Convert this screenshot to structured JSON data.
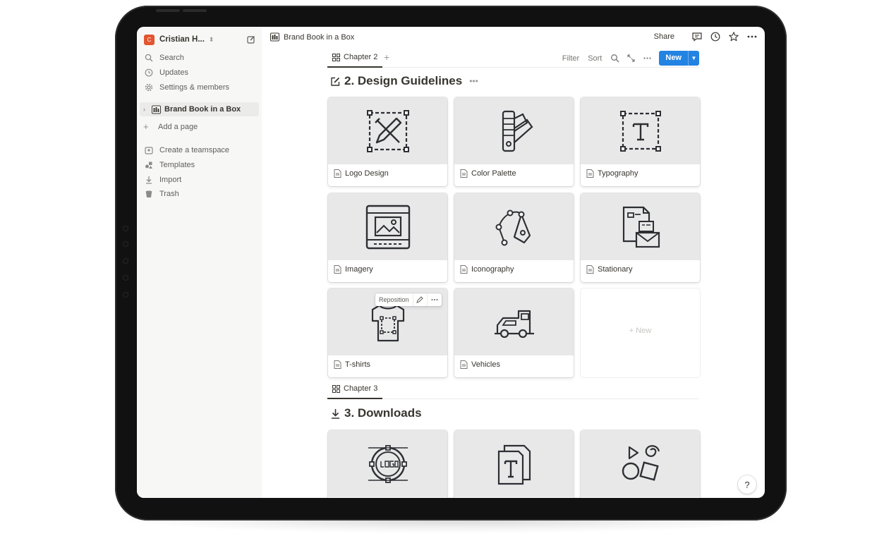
{
  "workspace": {
    "avatar_letter": "C",
    "name": "Cristian H...",
    "accent": "#e1552f"
  },
  "sidebar": {
    "nav": [
      {
        "label": "Search",
        "icon": "search-icon"
      },
      {
        "label": "Updates",
        "icon": "clock-icon"
      },
      {
        "label": "Settings & members",
        "icon": "gear-icon"
      }
    ],
    "page": {
      "label": "Brand Book in a Box",
      "icon": "book-icon"
    },
    "add_page": "Add a page",
    "extras": [
      {
        "label": "Create a teamspace",
        "icon": "teamspace-icon"
      },
      {
        "label": "Templates",
        "icon": "templates-icon"
      },
      {
        "label": "Import",
        "icon": "import-icon"
      },
      {
        "label": "Trash",
        "icon": "trash-icon"
      }
    ]
  },
  "topbar": {
    "breadcrumb": "Brand Book in a Box",
    "share": "Share"
  },
  "views": {
    "chapter2": "Chapter 2",
    "chapter3": "Chapter 3",
    "filter": "Filter",
    "sort": "Sort",
    "new": "New",
    "accent": "#2383e2"
  },
  "sections": {
    "design": {
      "title": "2. Design Guidelines",
      "icon": "edit-icon"
    },
    "downloads": {
      "title": "3. Downloads",
      "icon": "download-icon"
    }
  },
  "cards": [
    {
      "label": "Logo Design",
      "icon": "logo-design-icon"
    },
    {
      "label": "Color Palette",
      "icon": "color-palette-icon"
    },
    {
      "label": "Typography",
      "icon": "typography-icon"
    },
    {
      "label": "Imagery",
      "icon": "imagery-icon"
    },
    {
      "label": "Iconography",
      "icon": "iconography-icon"
    },
    {
      "label": "Stationary",
      "icon": "stationary-icon"
    },
    {
      "label": "T-shirts",
      "icon": "tshirt-icon"
    },
    {
      "label": "Vehicles",
      "icon": "vehicle-icon"
    }
  ],
  "new_card": "New",
  "reposition": "Reposition",
  "download_cards": [
    {
      "icon": "logo-download-icon"
    },
    {
      "icon": "font-download-icon"
    },
    {
      "icon": "shapes-icon"
    }
  ],
  "help": "?"
}
